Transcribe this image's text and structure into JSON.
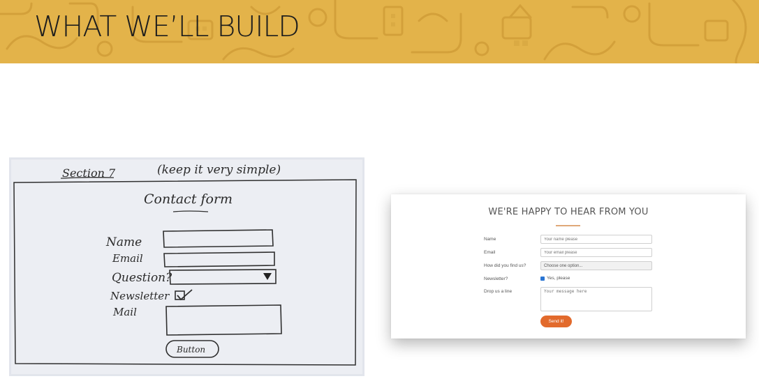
{
  "header": {
    "title": "WHAT WE’LL BUILD"
  },
  "sketch": {
    "section_label": "Section 7",
    "note": "(keep it very simple)",
    "form_title": "Contact form",
    "fields": [
      "Name",
      "Email",
      "Question?",
      "Newsletter",
      "Mail"
    ],
    "button_label": "Button"
  },
  "form": {
    "title": "WE'RE HAPPY TO HEAR FROM YOU",
    "name_label": "Name",
    "name_placeholder": "Your name please",
    "email_label": "Email",
    "email_placeholder": "Your email please",
    "source_label": "How did you find us?",
    "source_selected": "Choose one option...",
    "newsletter_label": "Newsletter?",
    "newsletter_option": "Yes, please",
    "newsletter_checked": true,
    "message_label": "Drop us a line",
    "message_placeholder": "Your message here",
    "submit_label": "Send it!"
  },
  "colors": {
    "banner": "#e3b34a",
    "accent": "#e26a2c",
    "checkbox": "#2a75d3"
  }
}
